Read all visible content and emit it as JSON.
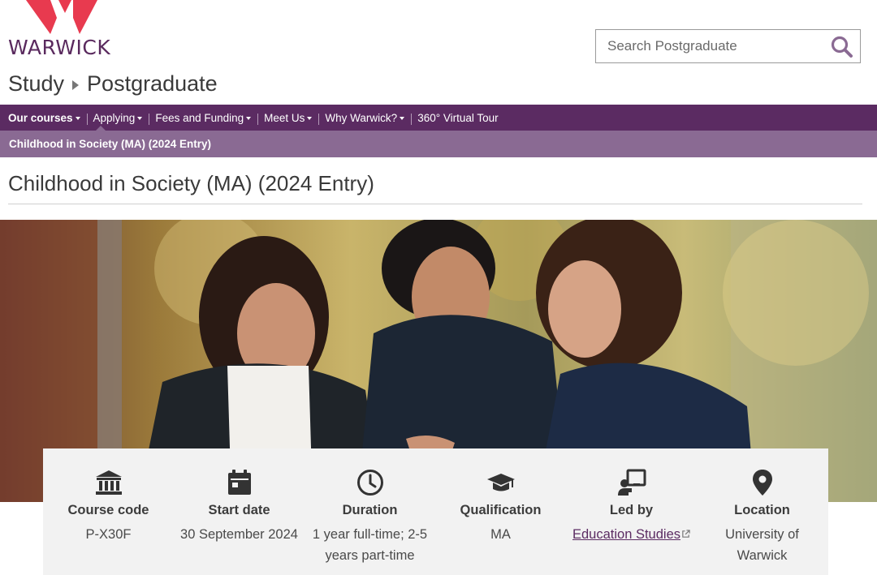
{
  "header": {
    "logo_text": "WARWICK",
    "search": {
      "placeholder": "Search Postgraduate",
      "value": ""
    },
    "breadcrumb": [
      "Study",
      "Postgraduate"
    ]
  },
  "nav": {
    "items": [
      {
        "label": "Our courses",
        "has_caret": true,
        "active": true
      },
      {
        "label": "Applying",
        "has_caret": true
      },
      {
        "label": "Fees and Funding",
        "has_caret": true
      },
      {
        "label": "Meet Us",
        "has_caret": true
      },
      {
        "label": "Why Warwick?",
        "has_caret": true
      },
      {
        "label": "360° Virtual Tour",
        "has_caret": false
      }
    ],
    "subnav_item": "Childhood in Society (MA) (2024 Entry)"
  },
  "page": {
    "title": "Childhood in Society (MA) (2024 Entry)"
  },
  "course_info": [
    {
      "icon": "bank-icon",
      "label": "Course code",
      "value": "P-X30F"
    },
    {
      "icon": "calendar-icon",
      "label": "Start date",
      "value": "30 September 2024"
    },
    {
      "icon": "clock-icon",
      "label": "Duration",
      "value": "1 year full-time; 2-5 years part-time"
    },
    {
      "icon": "graduation-cap-icon",
      "label": "Qualification",
      "value": "MA"
    },
    {
      "icon": "teacher-icon",
      "label": "Led by",
      "value": "Education Studies",
      "is_link": true
    },
    {
      "icon": "map-pin-icon",
      "label": "Location",
      "value": "University of Warwick"
    }
  ],
  "colors": {
    "brand_purple": "#5b2b62",
    "subnav_purple": "#8a6a93",
    "logo_red": "#e83a4f"
  }
}
